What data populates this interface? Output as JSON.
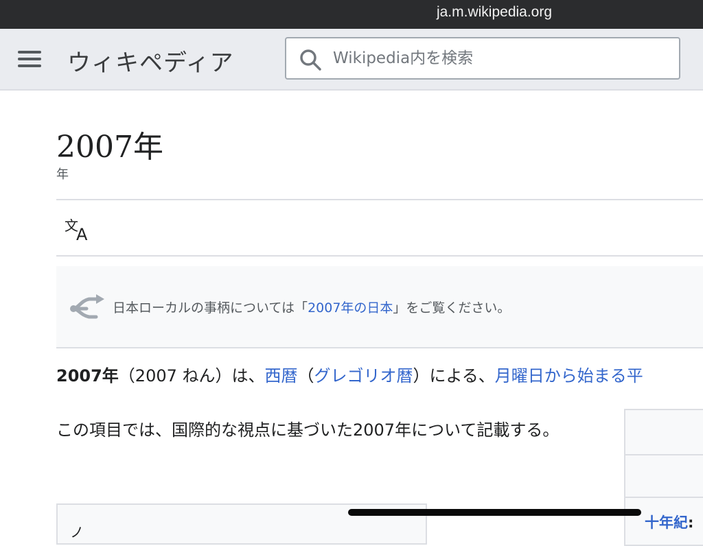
{
  "status_bar": {
    "url": "ja.m.wikipedia.org"
  },
  "header": {
    "logo_text": "ウィキペディア",
    "search": {
      "placeholder": "Wikipedia内を検索",
      "value": ""
    }
  },
  "page": {
    "title": "2007年",
    "subtitle": "年",
    "hatnote": {
      "prefix": "日本ローカルの事柄については「",
      "link": "2007年の日本",
      "suffix": "」をご覧ください。"
    },
    "lead": {
      "bold": "2007年",
      "text1": "（2007 ねん）は、",
      "link1": "西暦",
      "text2": "（",
      "link2": "グレゴリオ暦",
      "text3": "）による、",
      "link3": "月曜日から始まる平"
    },
    "scope": "この項目では、国際的な視点に基づいた2007年について記載する。",
    "toc_glyph": "ノ"
  },
  "infobox": {
    "label": "十年紀",
    "colon": ":"
  },
  "colors": {
    "link": "#3366cc",
    "status_bar": "#2b2c2e",
    "header_bg": "#eaecf0",
    "hatnote_bg": "#f8f9fa"
  },
  "icons": [
    "hamburger-menu-icon",
    "search-icon",
    "language-icon",
    "disambiguation-icon"
  ]
}
